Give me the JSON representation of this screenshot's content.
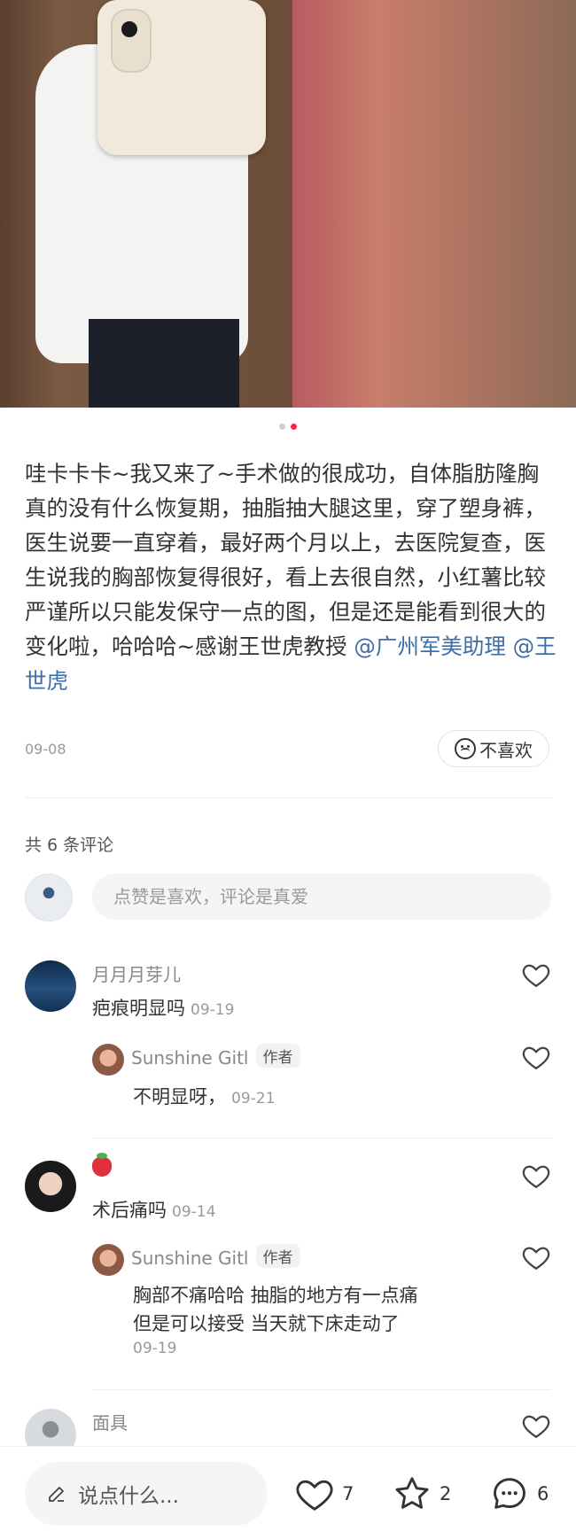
{
  "carousel": {
    "total": 2,
    "active_index": 1
  },
  "post": {
    "text": "哇卡卡卡~我又来了~手术做的很成功，自体脂肪隆胸真的没有什么恢复期，抽脂抽大腿这里，穿了塑身裤，医生说要一直穿着，最好两个月以上，去医院复查，医生说我的胸部恢复得很好，看上去很自然，小红薯比较严谨所以只能发保守一点的图，但是还是能看到很大的变化啦，哈哈哈~感谢王世虎教授",
    "mentions": [
      "@广州军美助理",
      "@王世虎"
    ],
    "date": "09-08",
    "dislike_label": "不喜欢"
  },
  "comments_header": {
    "count_text": "共 6 条评论"
  },
  "comment_input": {
    "placeholder": "点赞是喜欢，评论是真爱"
  },
  "comments": [
    {
      "name": "月月月芽儿",
      "text": "疤痕明显吗",
      "time": "09-19",
      "reply": {
        "name": "Sunshine Gitl",
        "badge": "作者",
        "text": "不明显呀，",
        "time": "09-21"
      }
    },
    {
      "name": "",
      "name_icon": "strawberry-emoji",
      "text": "术后痛吗",
      "time": "09-14",
      "reply": {
        "name": "Sunshine Gitl",
        "badge": "作者",
        "line1": "胸部不痛哈哈 抽脂的地方有一点痛",
        "line2": "但是可以接受 当天就下床走动了",
        "time": "09-19"
      }
    },
    {
      "name": "面具"
    }
  ],
  "bottom_bar": {
    "input_placeholder": "说点什么...",
    "likes": "7",
    "collects": "2",
    "comments": "6"
  },
  "colors": {
    "accent": "#ff2442",
    "mention": "#3c6ea8"
  },
  "icons": [
    "heart-icon",
    "star-icon",
    "comment-bubble-icon",
    "pencil-icon",
    "sad-face-icon"
  ]
}
